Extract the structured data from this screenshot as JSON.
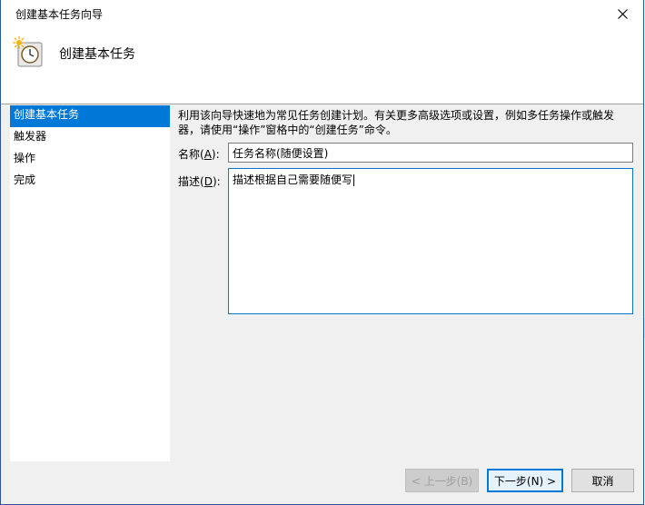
{
  "window": {
    "title": "创建基本任务向导"
  },
  "header": {
    "title": "创建基本任务",
    "icon": "scheduled-task-clock-icon"
  },
  "nav": {
    "items": [
      {
        "label": "创建基本任务",
        "active": true
      },
      {
        "label": "触发器"
      },
      {
        "label": "操作"
      },
      {
        "label": "完成"
      }
    ]
  },
  "main": {
    "description_line1": "利用该向导快速地为常见任务创建计划。有关更多高级选项或设置，例如多任务操作或触发",
    "description_line2": "器，请使用“操作”窗格中的“创建任务”命令。",
    "name_label": "名称(",
    "name_mnemonic": "A",
    "name_label_end": "):",
    "name_value": "任务名称(随便设置)",
    "desc_label": "描述(",
    "desc_mnemonic": "D",
    "desc_label_end": "):",
    "desc_value": "描述根据自己需要随便写"
  },
  "buttons": {
    "back": "< 上一步(B)",
    "next": "下一步(N) >",
    "cancel": "取消"
  },
  "colors": {
    "accent": "#0078d7",
    "border": "#2b579a"
  }
}
